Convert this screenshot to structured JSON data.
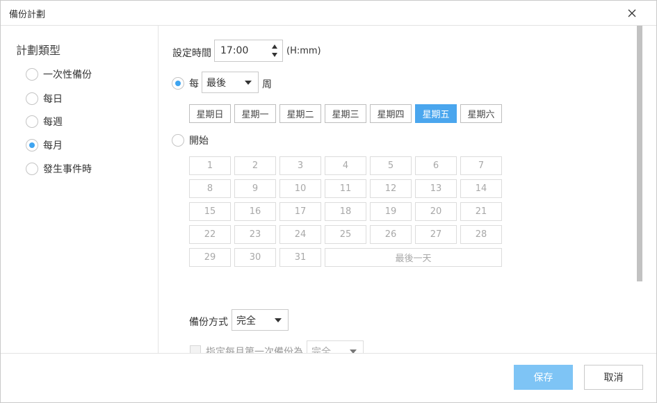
{
  "dialog": {
    "title": "備份計劃"
  },
  "plan_types": {
    "heading": "計劃類型",
    "options": [
      {
        "label": "一次性備份",
        "checked": false
      },
      {
        "label": "每日",
        "checked": false
      },
      {
        "label": "每週",
        "checked": false
      },
      {
        "label": "每月",
        "checked": true
      },
      {
        "label": "發生事件時",
        "checked": false
      }
    ]
  },
  "schedule": {
    "time_label": "設定時間",
    "time_value": "17:00",
    "time_format": "(H:mm)",
    "every_label": "每",
    "every_option": "最後",
    "week_label": "周",
    "weekdays": [
      "星期日",
      "星期一",
      "星期二",
      "星期三",
      "星期四",
      "星期五",
      "星期六"
    ],
    "selected_weekday": "星期五",
    "start_label": "開始",
    "days": [
      "1",
      "2",
      "3",
      "4",
      "5",
      "6",
      "7",
      "8",
      "9",
      "10",
      "11",
      "12",
      "13",
      "14",
      "15",
      "16",
      "17",
      "18",
      "19",
      "20",
      "21",
      "22",
      "23",
      "24",
      "25",
      "26",
      "27",
      "28",
      "29",
      "30",
      "31"
    ],
    "last_day_label": "最後一天"
  },
  "backup": {
    "method_label": "備份方式",
    "method_value": "完全",
    "first_backup_label": "指定每月第一次備份為",
    "first_backup_value": "完全"
  },
  "footer": {
    "save_label": "保存",
    "cancel_label": "取消"
  },
  "colors": {
    "accent": "#4aa6ee",
    "save_button": "#7ec4f5"
  }
}
